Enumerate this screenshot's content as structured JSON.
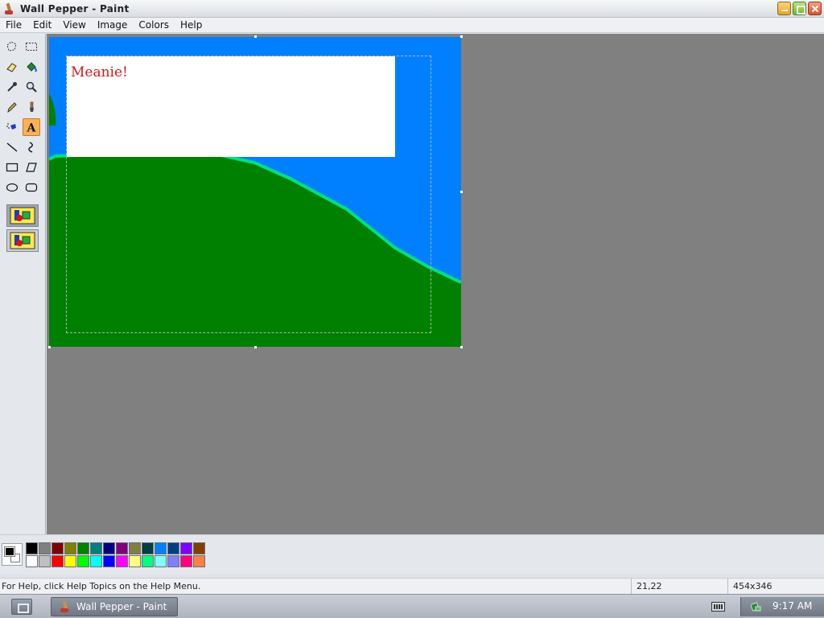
{
  "window": {
    "title": "Wall Pepper - Paint"
  },
  "menu": {
    "items": [
      "File",
      "Edit",
      "View",
      "Image",
      "Colors",
      "Help"
    ]
  },
  "toolbox": {
    "tools": [
      "free-form-select",
      "select",
      "eraser",
      "fill-with-color",
      "pick-color",
      "magnifier",
      "pencil",
      "brush",
      "airbrush",
      "text",
      "line",
      "curve",
      "rectangle",
      "polygon",
      "ellipse",
      "rounded-rectangle"
    ],
    "active_tool": "text"
  },
  "canvas": {
    "text": "Meanie!",
    "colors": {
      "sky": "#0080ff",
      "hill": "#008000",
      "hill_edge": "#00e080",
      "textbox": "#ffffff",
      "text": "#d01818"
    }
  },
  "palette": {
    "foreground": "#000000",
    "background": "#ffffff",
    "swatches_top": [
      "#000000",
      "#808080",
      "#800000",
      "#808000",
      "#008000",
      "#008080",
      "#000080",
      "#800080",
      "#808040",
      "#004040",
      "#0080ff",
      "#004080",
      "#8000ff",
      "#804000"
    ],
    "swatches_bottom": [
      "#ffffff",
      "#c0c0c0",
      "#ff0000",
      "#ffff00",
      "#00ff00",
      "#00ffff",
      "#0000ff",
      "#ff00ff",
      "#ffff80",
      "#00ff80",
      "#80ffff",
      "#8080ff",
      "#ff0080",
      "#ff8040"
    ]
  },
  "status": {
    "help": "For Help, click Help Topics on the Help Menu.",
    "position": "21,22",
    "size": "454x346"
  },
  "taskbar": {
    "task_label": "Wall Pepper - Paint",
    "clock": "9:17 AM"
  }
}
